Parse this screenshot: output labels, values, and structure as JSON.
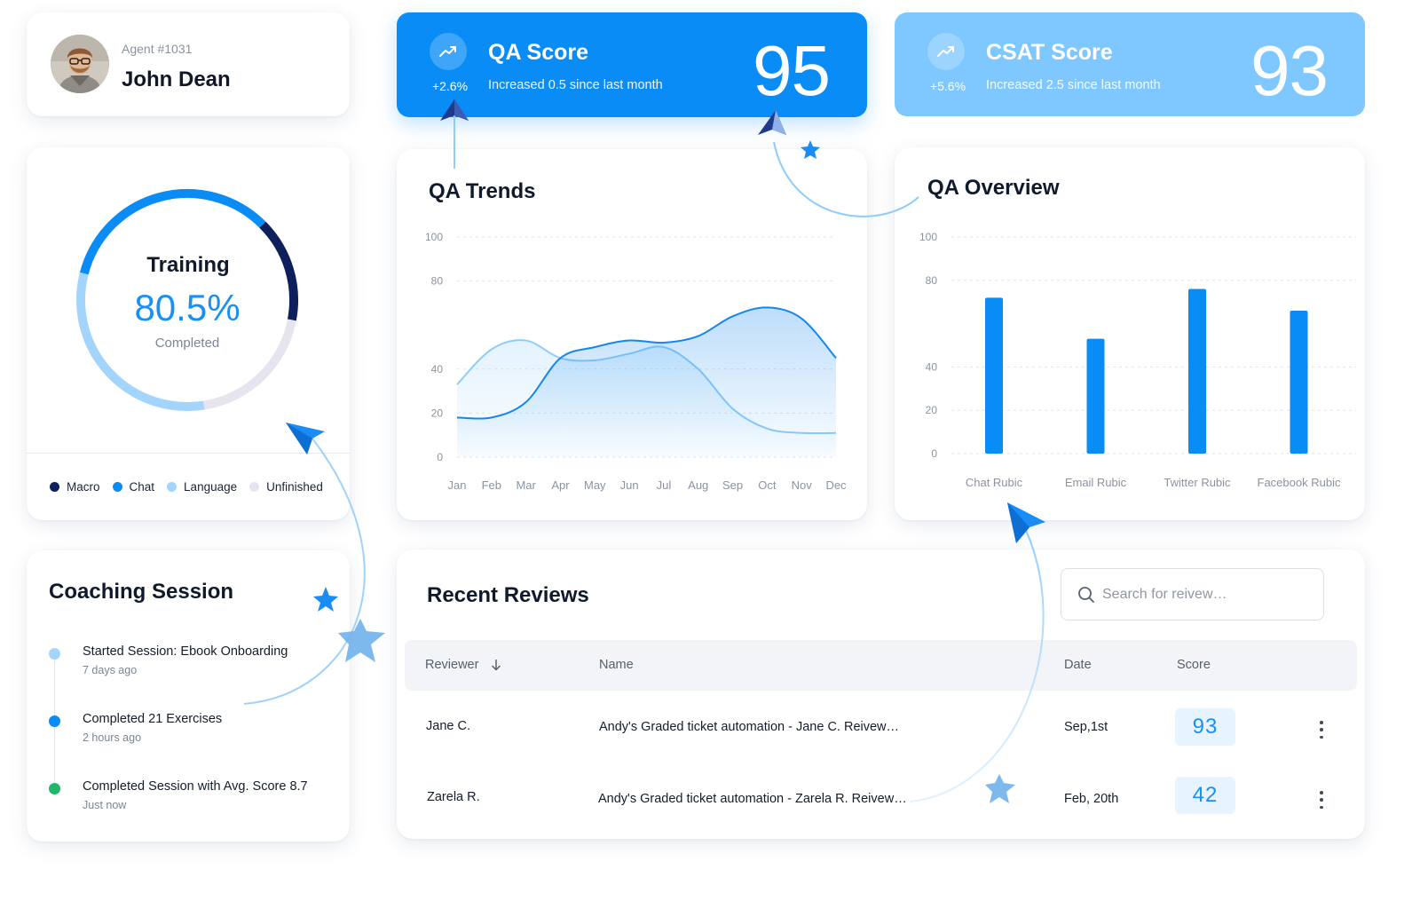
{
  "agent": {
    "id_label": "Agent #1031",
    "name": "John Dean"
  },
  "qa_score": {
    "title": "QA Score",
    "change": "+2.6%",
    "subtitle": "Increased 0.5 since last month",
    "value": "95",
    "color": "#0a8cf6",
    "icon": "trending-up-icon"
  },
  "csat_score": {
    "title": "CSAT Score",
    "change": "+5.6%",
    "subtitle": "Increased 2.5 since last month",
    "value": "93",
    "color": "#7ec8ff",
    "icon": "trending-up-icon"
  },
  "training": {
    "title": "Training",
    "percent": "80.5%",
    "subtitle": "Completed",
    "segments": [
      {
        "name": "Chat",
        "fraction": 0.335,
        "color": "#0a8cf6"
      },
      {
        "name": "Macro",
        "fraction": 0.155,
        "color": "#0e1f5b"
      },
      {
        "name": "Unfinished",
        "fraction": 0.195,
        "color": "#e6e4ef"
      },
      {
        "name": "Language",
        "fraction": 0.315,
        "color": "#a3d5fc"
      }
    ],
    "legend": [
      {
        "label": "Macro",
        "color": "#0e1f5b"
      },
      {
        "label": "Chat",
        "color": "#0a8cf6"
      },
      {
        "label": "Language",
        "color": "#a3d5fc"
      },
      {
        "label": "Unfinished",
        "color": "#e6e4ef"
      }
    ]
  },
  "qa_trends": {
    "title": "QA Trends",
    "chart_data": {
      "type": "area",
      "categories": [
        "Jan",
        "Feb",
        "Mar",
        "Apr",
        "May",
        "Jun",
        "Jul",
        "Aug",
        "Sep",
        "Oct",
        "Nov",
        "Dec"
      ],
      "yticks": [
        "100",
        "80",
        "40",
        "20",
        "0"
      ],
      "ylim": [
        0,
        100
      ],
      "grid": true,
      "series": [
        {
          "values": [
            18,
            18,
            25,
            45,
            50,
            53,
            52,
            55,
            64,
            68,
            63,
            45
          ],
          "color": "#1487ee"
        },
        {
          "values": [
            33,
            49,
            53,
            45,
            44,
            47,
            50,
            40,
            22,
            13,
            11,
            11
          ],
          "color": "#8fcdf9"
        }
      ]
    }
  },
  "qa_overview": {
    "title": "QA Overview",
    "chart_data": {
      "type": "bar",
      "categories": [
        "Chat Rubic",
        "Email Rubic",
        "Twitter Rubic",
        "Facebook Rubic"
      ],
      "values": [
        72,
        53,
        76,
        66
      ],
      "yticks": [
        "100",
        "80",
        "40",
        "20",
        "0"
      ],
      "ylim": [
        0,
        100
      ],
      "grid": true,
      "color": "#0a8cf6"
    }
  },
  "coaching": {
    "title": "Coaching Session",
    "items": [
      {
        "text": "Started Session: Ebook Onboarding",
        "time": "7 days ago",
        "color": "#a3d5fc"
      },
      {
        "text": "Completed 21 Exercises",
        "time": "2 hours ago",
        "color": "#0a8cf6"
      },
      {
        "text": "Completed Session with Avg. Score 8.7",
        "time": "Just now",
        "color": "#1fb86a"
      }
    ]
  },
  "reviews": {
    "title": "Recent Reviews",
    "search_placeholder": "Search for reivew…",
    "columns": {
      "reviewer": "Reviewer",
      "name": "Name",
      "date": "Date",
      "score": "Score"
    },
    "rows": [
      {
        "reviewer": "Jane C.",
        "name": "Andy's Graded ticket automation - Jane C. Reivew…",
        "date": "Sep,1st",
        "score": "93"
      },
      {
        "reviewer": "Zarela R.",
        "name": "Andy's Graded ticket automation - Zarela R. Reivew…",
        "date": "Feb, 20th",
        "score": "42"
      }
    ]
  }
}
